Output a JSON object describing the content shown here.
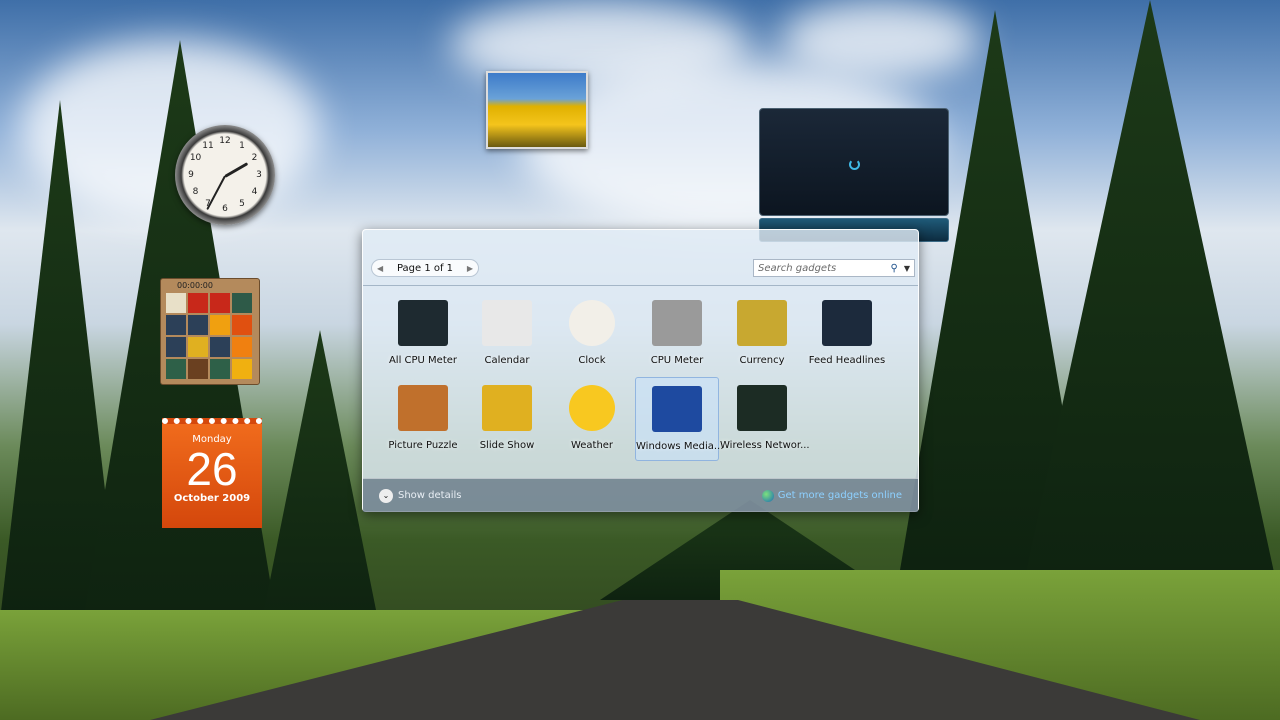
{
  "clock_gadget": {
    "numbers": [
      "12",
      "1",
      "2",
      "3",
      "4",
      "5",
      "6",
      "7",
      "8",
      "9",
      "10",
      "11"
    ]
  },
  "puzzle_gadget": {
    "timer": "00:00:00"
  },
  "calendar_gadget": {
    "weekday": "Monday",
    "day": "26",
    "month_year": "October 2009"
  },
  "gallery": {
    "pager": {
      "label": "Page 1 of 1"
    },
    "search": {
      "placeholder": "Search gadgets"
    },
    "items": [
      {
        "label": "All CPU Meter",
        "color": "#1e2a30"
      },
      {
        "label": "Calendar",
        "color": "#e8e8e8"
      },
      {
        "label": "Clock",
        "color": "#f2efe8"
      },
      {
        "label": "CPU Meter",
        "color": "#9a9a9a"
      },
      {
        "label": "Currency",
        "color": "#c8a830"
      },
      {
        "label": "Feed Headlines",
        "color": "#1c2a3c"
      },
      {
        "label": "Picture Puzzle",
        "color": "#c0702c"
      },
      {
        "label": "Slide Show",
        "color": "#e0b020"
      },
      {
        "label": "Weather",
        "color": "#f8c820"
      },
      {
        "label": "Windows Media...",
        "color": "#1e4aa0"
      },
      {
        "label": "Wireless Networ...",
        "color": "#1c2c24"
      }
    ],
    "selected": "Windows Media...",
    "show_details": "Show details",
    "get_more": "Get more gadgets online"
  }
}
